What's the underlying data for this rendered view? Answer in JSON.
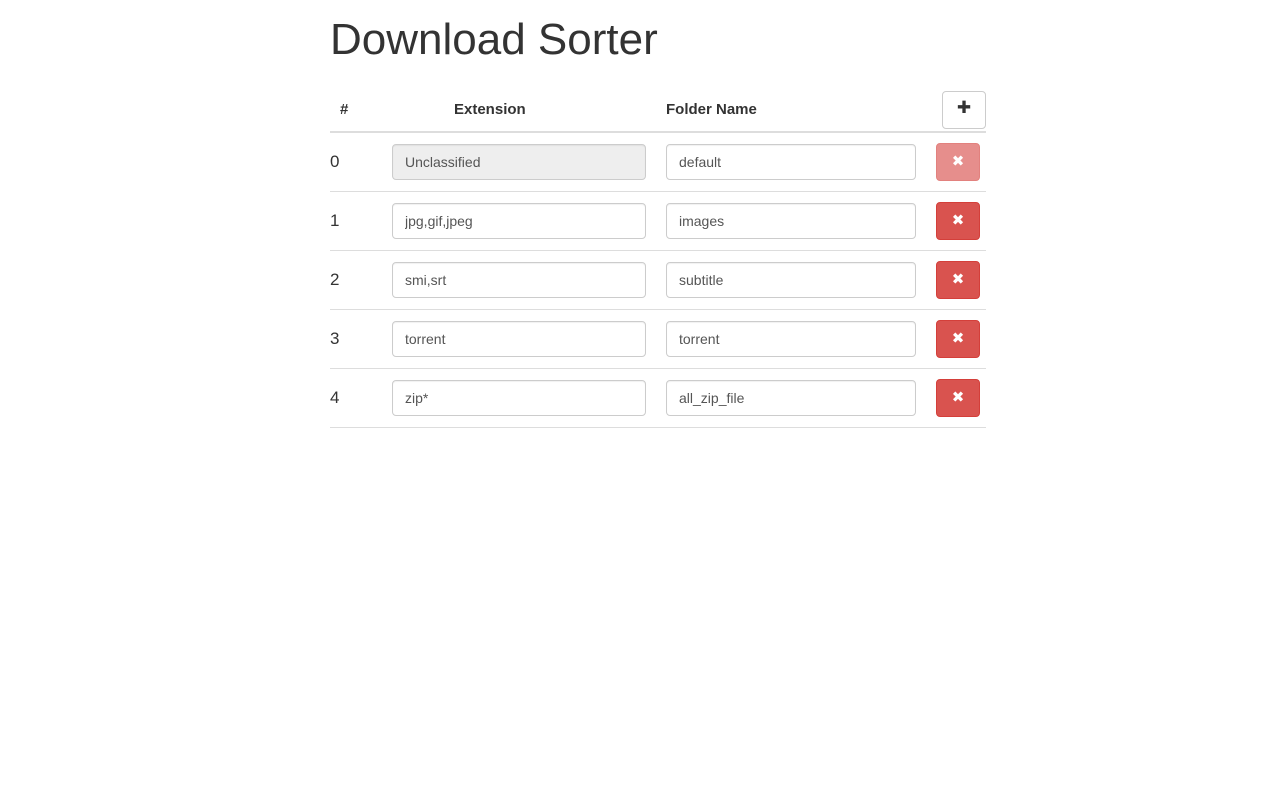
{
  "app": {
    "title": "Download Sorter"
  },
  "table": {
    "headers": {
      "index": "#",
      "extension": "Extension",
      "folder": "Folder Name"
    },
    "add_button": {
      "icon": "plus-icon",
      "glyph": "✚"
    },
    "delete_button": {
      "icon": "times-icon",
      "glyph": "✖"
    },
    "rows": [
      {
        "index": "0",
        "extension": "Unclassified",
        "folder": "default",
        "extension_disabled": true,
        "delete_disabled": true
      },
      {
        "index": "1",
        "extension": "jpg,gif,jpeg",
        "folder": "images",
        "extension_disabled": false,
        "delete_disabled": false
      },
      {
        "index": "2",
        "extension": "smi,srt",
        "folder": "subtitle",
        "extension_disabled": false,
        "delete_disabled": false
      },
      {
        "index": "3",
        "extension": "torrent",
        "folder": "torrent",
        "extension_disabled": false,
        "delete_disabled": false
      },
      {
        "index": "4",
        "extension": "zip*",
        "folder": "all_zip_file",
        "extension_disabled": false,
        "delete_disabled": false
      }
    ]
  },
  "colors": {
    "danger": "#d9534f",
    "danger_border": "#d43f3a",
    "text": "#333333",
    "input_text": "#555555",
    "border": "#dddddd",
    "input_border": "#cccccc",
    "disabled_bg": "#eeeeee",
    "page_bg": "#ffffff"
  }
}
